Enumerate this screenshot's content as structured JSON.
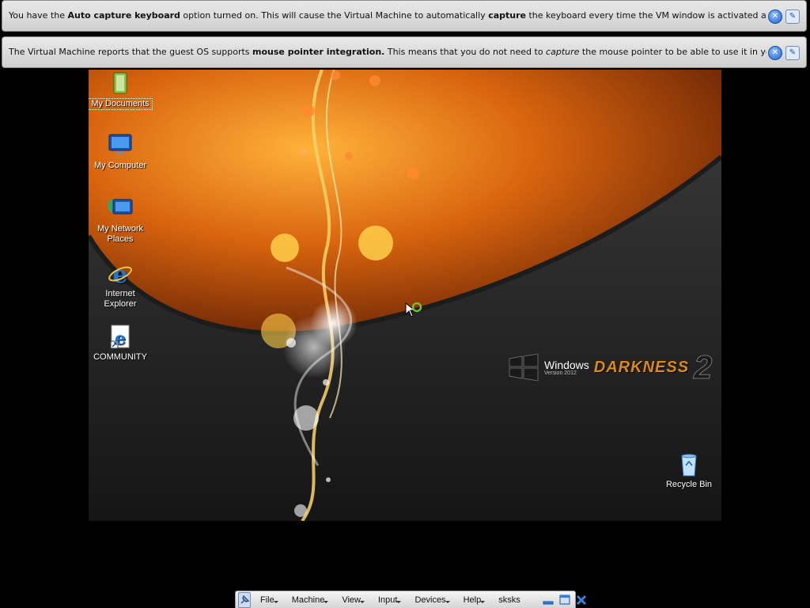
{
  "notifications": [
    {
      "segments": [
        {
          "text": "You have the ",
          "style": "normal"
        },
        {
          "text": "Auto capture keyboard",
          "style": "bold"
        },
        {
          "text": " option turned on. This will cause the Virtual Machine to automatically ",
          "style": "normal"
        },
        {
          "text": "capture",
          "style": "bold"
        },
        {
          "text": " the keyboard every time the VM window is activated and make it unavailable to",
          "style": "normal"
        }
      ],
      "close_icon": "close-icon",
      "mute_icon": "dont-show-again-icon"
    },
    {
      "segments": [
        {
          "text": "The Virtual Machine reports that the guest OS supports ",
          "style": "normal"
        },
        {
          "text": "mouse pointer integration.",
          "style": "bold"
        },
        {
          "text": " This means that you do not need to ",
          "style": "normal"
        },
        {
          "text": "capture",
          "style": "italic"
        },
        {
          "text": " the mouse pointer to be able to use it in your guest OS -- all mouse",
          "style": "normal"
        }
      ],
      "close_icon": "close-icon",
      "mute_icon": "dont-show-again-icon"
    }
  ],
  "desktop": {
    "icons": [
      {
        "label": "My Documents",
        "icon": "folder-documents-icon"
      },
      {
        "label": "My Computer",
        "icon": "computer-icon"
      },
      {
        "label": "My Network Places",
        "icon": "network-icon"
      },
      {
        "label": "Internet Explorer",
        "icon": "internet-explorer-icon"
      },
      {
        "label": "COMMUNITY",
        "icon": "internet-shortcut-icon"
      },
      {
        "label": "Recycle Bin",
        "icon": "recycle-bin-icon"
      }
    ],
    "wallpaper_logo": {
      "windows": "Windows",
      "version": "Version 2012",
      "brand": "DARKNESS",
      "number": "2"
    }
  },
  "vm_toolbar": {
    "menus": [
      "File",
      "Machine",
      "View",
      "Input",
      "Devices",
      "Help"
    ],
    "vm_name": "sksks"
  },
  "colors": {
    "banner_bg": "#dcdcdc",
    "wallpaper_orange": "#e07a1a",
    "wallpaper_dark": "#2a2a2a"
  }
}
